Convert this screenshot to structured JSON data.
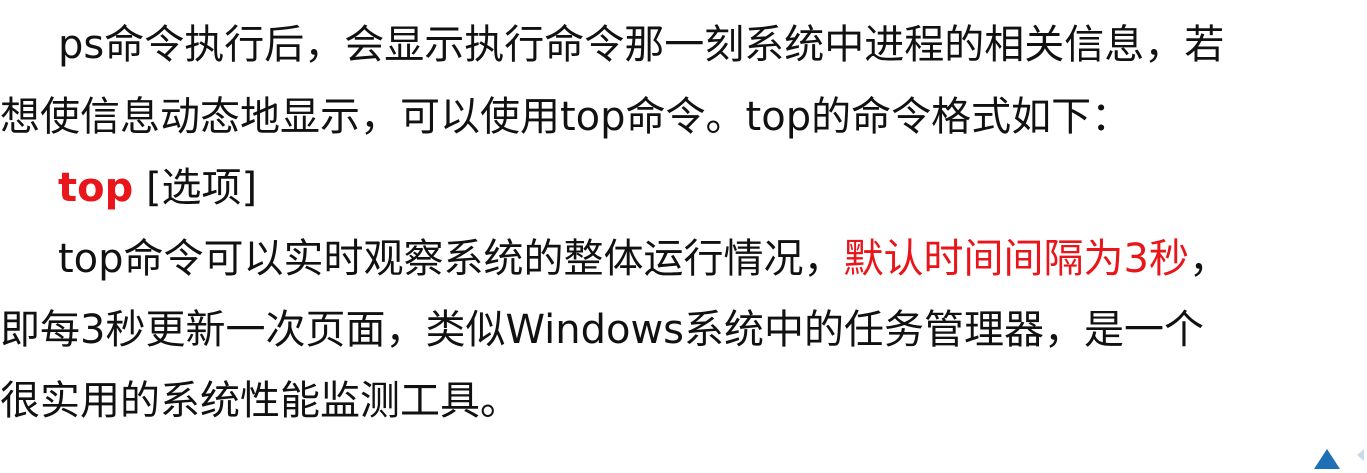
{
  "paragraph1": {
    "line1": "ps命令执行后，会显示执行命令那一刻系统中进程的相关信息，若",
    "line2": "想使信息动态地显示，可以使用top命令。top的命令格式如下："
  },
  "syntax": {
    "command": "top",
    "option": " [选项]"
  },
  "paragraph2": {
    "line1_before": "top命令可以实时观察系统的整体运行情况，",
    "line1_highlight": "默认时间间隔为3秒",
    "line1_after": "，",
    "line2": "即每3秒更新一次页面，类似Windows系统中的任务管理器，是一个",
    "line3": "很实用的系统性能监测工具。"
  },
  "colors": {
    "text": "#111111",
    "highlight": "#e8161a",
    "nav_arrow": "#1f6fb5"
  },
  "icons": {
    "nav": "triangle-up-icon"
  }
}
